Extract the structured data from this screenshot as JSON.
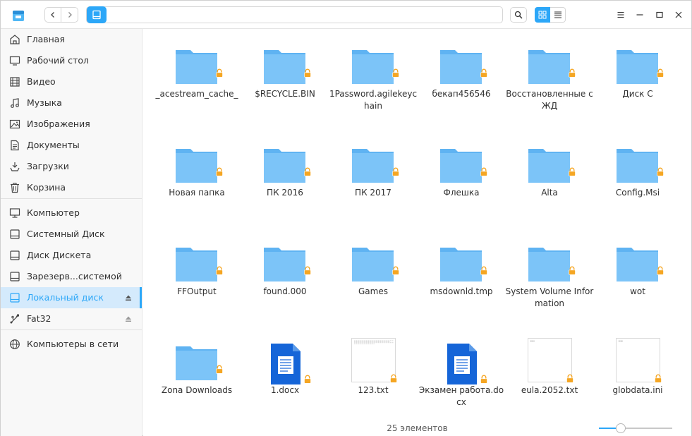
{
  "sidebar": {
    "items": [
      {
        "label": "Главная",
        "icon": "home-icon"
      },
      {
        "label": "Рабочий стол",
        "icon": "desktop-icon"
      },
      {
        "label": "Видео",
        "icon": "video-icon"
      },
      {
        "label": "Музыка",
        "icon": "music-icon"
      },
      {
        "label": "Изображения",
        "icon": "image-icon"
      },
      {
        "label": "Документы",
        "icon": "document-icon"
      },
      {
        "label": "Загрузки",
        "icon": "download-icon"
      },
      {
        "label": "Корзина",
        "icon": "trash-icon"
      },
      {
        "label": "Компьютер",
        "icon": "computer-icon"
      },
      {
        "label": "Системный Диск",
        "icon": "disk-icon"
      },
      {
        "label": "Диск Дискета",
        "icon": "disk-icon"
      },
      {
        "label": "Зарезерв...системой",
        "icon": "disk-icon"
      },
      {
        "label": "Локальный диск",
        "icon": "disk-icon",
        "active": true
      },
      {
        "label": "Fat32",
        "icon": "usb-icon"
      },
      {
        "label": "Компьютеры в сети",
        "icon": "network-icon"
      }
    ]
  },
  "files": [
    {
      "name": "_acestream_cache_",
      "type": "folder"
    },
    {
      "name": "$RECYCLE.BIN",
      "type": "folder"
    },
    {
      "name": "1Password.agilekeychain",
      "type": "folder"
    },
    {
      "name": "бекап456546",
      "type": "folder"
    },
    {
      "name": "Восстановленные с ЖД",
      "type": "folder"
    },
    {
      "name": "Диск С",
      "type": "folder"
    },
    {
      "name": "Новая папка",
      "type": "folder"
    },
    {
      "name": "ПК 2016",
      "type": "folder"
    },
    {
      "name": "ПК 2017",
      "type": "folder"
    },
    {
      "name": "Флешка",
      "type": "folder"
    },
    {
      "name": "Alta",
      "type": "folder"
    },
    {
      "name": "Config.Msi",
      "type": "folder"
    },
    {
      "name": "FFOutput",
      "type": "folder"
    },
    {
      "name": "found.000",
      "type": "folder"
    },
    {
      "name": "Games",
      "type": "folder"
    },
    {
      "name": "msdownld.tmp",
      "type": "folder"
    },
    {
      "name": "System Volume Information",
      "type": "folder"
    },
    {
      "name": "wot",
      "type": "folder"
    },
    {
      "name": "Zona Downloads",
      "type": "folder"
    },
    {
      "name": "1.docx",
      "type": "docx"
    },
    {
      "name": "123.txt",
      "type": "txt"
    },
    {
      "name": "Экзамен работа.docx",
      "type": "docx"
    },
    {
      "name": "eula.2052.txt",
      "type": "txt"
    },
    {
      "name": "globdata.ini",
      "type": "txt"
    }
  ],
  "status": {
    "count_text": "25 элементов"
  },
  "zoom_level": 0.25,
  "colors": {
    "accent": "#2ca7f8",
    "folder": "#7cc4f8",
    "folder_tab": "#5fb3f2",
    "doc": "#1565d8",
    "lock": "#f5a623"
  }
}
